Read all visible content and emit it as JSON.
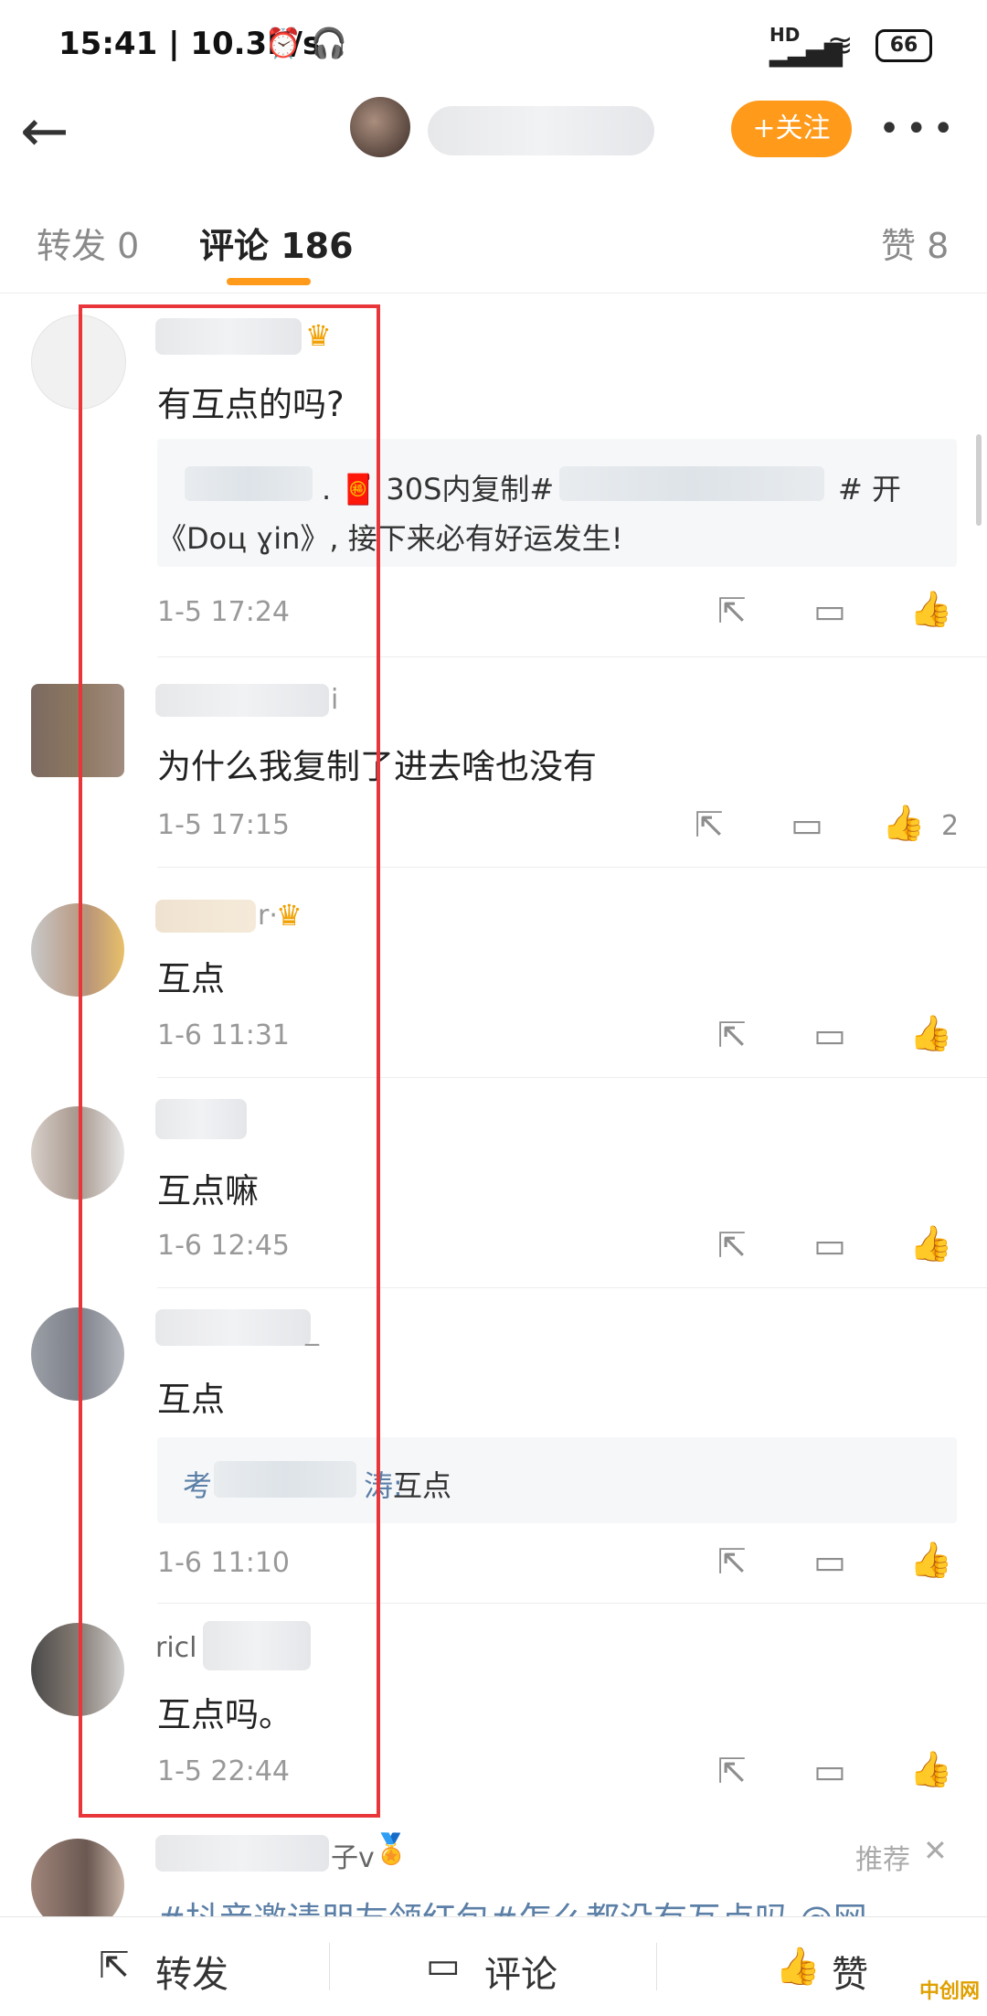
{
  "status_bar": {
    "time": "15:41 | 10.3K/s",
    "alarm_icon": "alarm-icon",
    "headset_icon": "headset-icon",
    "signal_label": "HD",
    "battery": "66"
  },
  "nav": {
    "back_icon": "arrow-left-icon",
    "follow_label": "+关注",
    "more_icon": "more-dots-icon"
  },
  "tabs": [
    {
      "label": "转发 0"
    },
    {
      "label": "评论 186"
    },
    {
      "label": "赞 8"
    }
  ],
  "comments": [
    {
      "name": "",
      "text": "有互点的吗?",
      "quote_line1": ". 🧧 30S内复制#",
      "quote_tail1": "# 开",
      "quote_line2": "《Doц ɣin》, 接下来必有好运发生!",
      "time": "1-5 17:24",
      "likes": ""
    },
    {
      "name_suffix": "i",
      "text": "为什么我复制了进去啥也没有",
      "time": "1-5 17:15",
      "likes": "2"
    },
    {
      "name_suffix": "r·",
      "text": "互点",
      "time": "1-6 11:31",
      "likes": ""
    },
    {
      "name_suffix": "",
      "text": "互点嘛",
      "time": "1-6 12:45",
      "likes": ""
    },
    {
      "name_suffix": "_",
      "text": "互点",
      "quote_prefix": "考",
      "quote_mid": "涛:",
      "quote_text": "互点",
      "time": "1-6 11:10",
      "likes": ""
    },
    {
      "name_prefix": "ricl",
      "text": "互点吗。",
      "time": "1-5 22:44",
      "likes": ""
    }
  ],
  "last_comment": {
    "name_suffix": "子v",
    "recommend": "推荐",
    "close_icon": "close-icon",
    "text": "#抖音邀请朋友领红包#怎么都没有互点吗 @网"
  },
  "bottom_bar": {
    "repost": "转发",
    "comment": "评论",
    "like": "赞"
  },
  "watermark": "中创网"
}
